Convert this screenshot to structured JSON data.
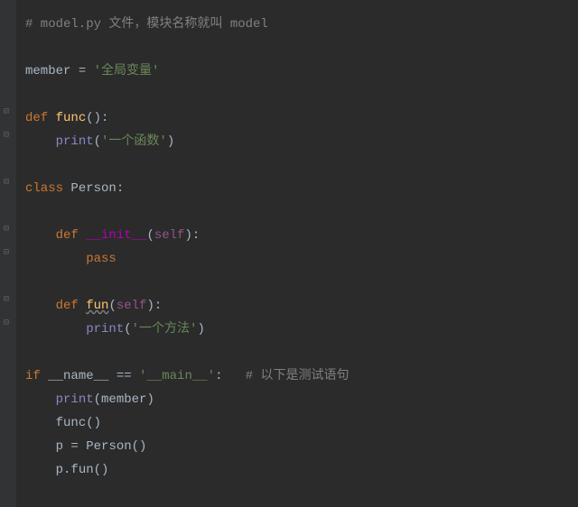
{
  "code": {
    "line1_comment": "# model.py 文件，模块名称就叫 model",
    "line3_member": "member",
    "line3_equals": " = ",
    "line3_string": "'全局变量'",
    "line5_def": "def ",
    "line5_func": "func",
    "line5_parens": "():",
    "line6_indent": "    ",
    "line6_print": "print",
    "line6_open": "(",
    "line6_string": "'一个函数'",
    "line6_close": ")",
    "line8_class": "class ",
    "line8_name": "Person",
    "line8_colon": ":",
    "line10_indent": "    ",
    "line10_def": "def ",
    "line10_init": "__init__",
    "line10_open": "(",
    "line10_self": "self",
    "line10_close": "):",
    "line11_indent": "        ",
    "line11_pass": "pass",
    "line13_indent": "    ",
    "line13_def": "def ",
    "line13_fun": "fun",
    "line13_open": "(",
    "line13_self": "self",
    "line13_close": "):",
    "line14_indent": "        ",
    "line14_print": "print",
    "line14_open": "(",
    "line14_string": "'一个方法'",
    "line14_close": ")",
    "line16_if": "if ",
    "line16_name": "__name__",
    "line16_eq": " == ",
    "line16_main": "'__main__'",
    "line16_colon": ":",
    "line16_space": "   ",
    "line16_comment": "# 以下是测试语句",
    "line17_indent": "    ",
    "line17_print": "print",
    "line17_open": "(",
    "line17_member": "member",
    "line17_close": ")",
    "line18_indent": "    ",
    "line18_func": "func",
    "line18_parens": "()",
    "line19_indent": "    ",
    "line19_p": "p",
    "line19_eq": " = ",
    "line19_person": "Person",
    "line19_parens": "()",
    "line20_indent": "    ",
    "line20_p": "p",
    "line20_dot": ".",
    "line20_fun": "fun",
    "line20_parens": "()"
  },
  "gutter_icons": {
    "fold1": "⊟",
    "fold2": "⊟",
    "fold3": "⊟",
    "fold4": "⊟",
    "fold5": "⊟",
    "fold6": "⊟",
    "fold7": "⊟"
  }
}
